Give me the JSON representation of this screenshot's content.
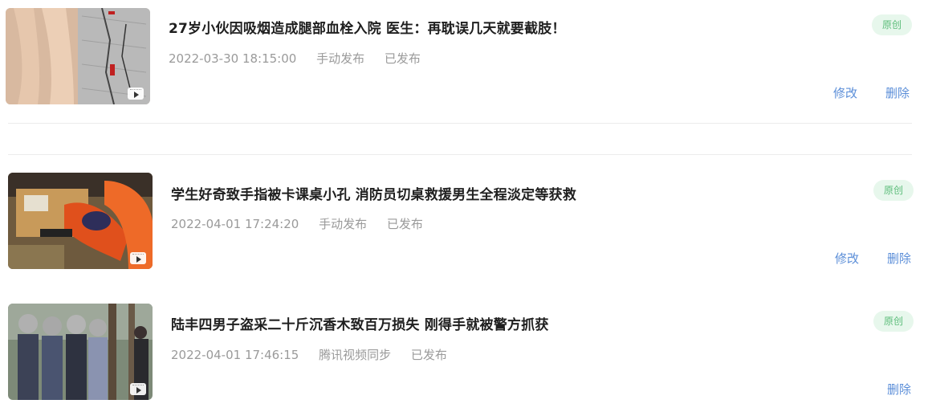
{
  "articles": [
    {
      "title": "27岁小伙因吸烟造成腿部血栓入院 医生：再耽误几天就要截肢！",
      "date": "2022-03-30 18:15:00",
      "method": "手动发布",
      "status": "已发布",
      "badge": "原创",
      "edit_label": "修改",
      "delete_label": "删除",
      "thumb_icon": "video-play-icon"
    },
    {
      "title": "学生好奇致手指被卡课桌小孔 消防员切桌救援男生全程淡定等获救",
      "date": "2022-04-01 17:24:20",
      "method": "手动发布",
      "status": "已发布",
      "badge": "原创",
      "edit_label": "修改",
      "delete_label": "删除",
      "thumb_icon": "video-play-icon"
    },
    {
      "title": "陆丰四男子盗采二十斤沉香木致百万损失 刚得手就被警方抓获",
      "date": "2022-04-01 17:46:15",
      "method": "腾讯视频同步",
      "status": "已发布",
      "badge": "原创",
      "delete_label": "删除",
      "thumb_icon": "video-play-icon"
    }
  ],
  "colors": {
    "action_link": "#5b8ed8",
    "badge_bg": "#e7f7ec",
    "badge_text": "#5cbd7a",
    "meta_text": "#9a9a9a",
    "title_text": "#1f1f1f"
  }
}
